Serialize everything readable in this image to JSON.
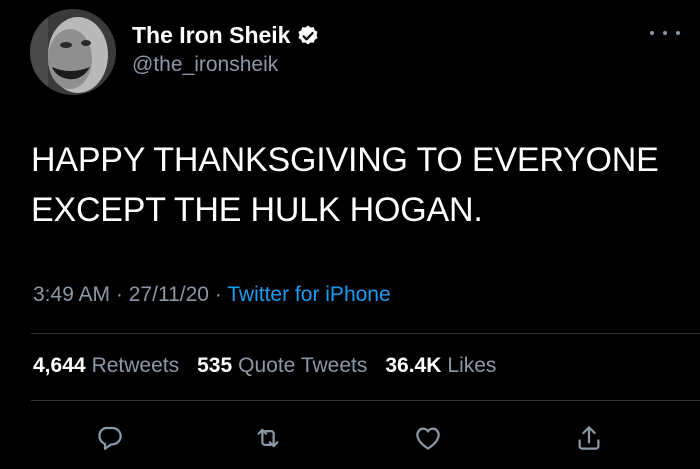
{
  "author": {
    "name": "The Iron Sheik",
    "handle": "@the_ironsheik",
    "verified": true
  },
  "tweet": {
    "text_lines": [
      "HAPPY THANKSGIVING TO EVERYONE",
      "EXCEPT THE HULK HOGAN."
    ],
    "time": "3:49 AM",
    "separator": "·",
    "date": "27/11/20",
    "source": "Twitter for iPhone"
  },
  "stats": {
    "retweets_count": "4,644",
    "retweets_label": "Retweets",
    "quotes_count": "535",
    "quotes_label": "Quote Tweets",
    "likes_count": "36.4K",
    "likes_label": "Likes"
  },
  "icons": {
    "reply": "reply-icon",
    "retweet": "retweet-icon",
    "like": "heart-icon",
    "share": "share-icon",
    "more": "more-icon",
    "verified": "verified-badge-icon"
  },
  "colors": {
    "background": "#000000",
    "text": "#ffffff",
    "secondary": "#8b98a5",
    "accent": "#1d9bf0",
    "divider": "#2f3336"
  }
}
